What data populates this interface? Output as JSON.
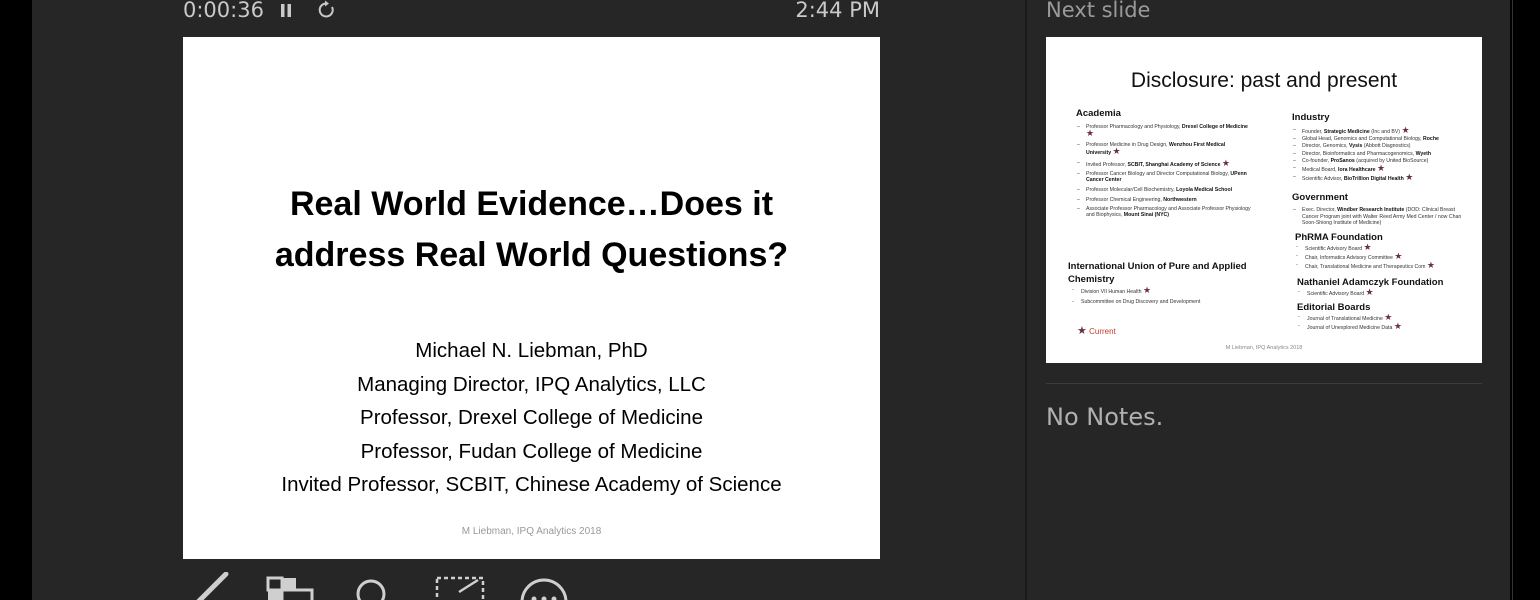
{
  "presenter": {
    "elapsed_time": "0:00:36",
    "clock": "2:44 PM",
    "icons": [
      "pause-icon",
      "restart-icon",
      "pen-icon",
      "slide-grid-icon",
      "zoom-icon",
      "crop-icon",
      "more-icon"
    ]
  },
  "current_slide": {
    "title_lines": [
      "Real World Evidence…Does it",
      "address Real World Questions?"
    ],
    "author_lines": [
      "Michael N. Liebman, PhD",
      "Managing Director, IPQ Analytics, LLC",
      "Professor, Drexel College of Medicine",
      "Professor, Fudan College of Medicine",
      "Invited Professor, SCBIT, Chinese Academy of Science"
    ],
    "footer": "M Liebman, IPQ Analytics 2018"
  },
  "next_slide": {
    "label": "Next slide",
    "title": "Disclosure: past and present",
    "sections": {
      "academia": "Academia",
      "iupac": "International Union of Pure and Applied Chemistry",
      "industry": "Industry",
      "government": "Government",
      "phrma": "PhRMA Foundation",
      "adamczyk": "Nathaniel Adamczyk Foundation",
      "editorial": "Editorial Boards"
    },
    "academia_items": {
      "a1_text": "Professor Pharmacology and Physiology, ",
      "a1_bold": "Drexel College of Medicine",
      "a2_text": "Professor Medicine in Drug Design, ",
      "a2_bold": "Wenzhou First Medical University",
      "a3_text": "Invited Professor, ",
      "a3_bold": "SCBIT, Shanghai Academy of Science",
      "a4_text": "Professor Cancer Biology and Director Computational Biology, ",
      "a4_bold": "UPenn Cancer Center",
      "a5_text": "Professor Molecular/Cell Biochemistry, ",
      "a5_bold": "Loyola Medical School",
      "a6_text": "Professor Chemical Engineering, ",
      "a6_bold": "Northwestern",
      "a7_text": "Associate Professor Pharmacology and Associate Professor Physiology and Biophysics, ",
      "a7_bold": "Mount Sinai (NYC)"
    },
    "iupac_items": [
      "Division VII Human Health",
      "Subcommittee on Drug Discovery and Development"
    ],
    "industry_items": {
      "i1_text": "Founder, ",
      "i1_bold": "Strategic Medicine",
      "i1_tail": " (Inc and BV)",
      "i2_text": "Global Head, Genomics and Computational Biology, ",
      "i2_bold": "Roche",
      "i3_text": "Director, Genomics, ",
      "i3_bold": "Vysis",
      "i3_tail": " (Abbott Diagnostics)",
      "i4_text": "Director, Bioinformatics and Pharmacogenomics, ",
      "i4_bold": "Wyeth",
      "i5_text": "Co-founder, ",
      "i5_bold": "ProSanos",
      "i5_tail": " (acquired by United BioSource)",
      "i6_text": "Medical Board, ",
      "i6_bold": "Iora Healthcare",
      "i7_text": "Scientific Advisor, ",
      "i7_bold": "BioTrillion Digital Health"
    },
    "government_items": {
      "g1_text": "Exec. Director, ",
      "g1_bold": "Windber Research Institute",
      "g1_tail": " (DOD: Clinical Breast Cancer Program joint with Walter Reed Army Med Center / now Chan Soon-Shiong Institute of Medicine)"
    },
    "phrma_items": [
      "Scientific Advisory Board",
      "Chair, Informatics Advisory Committee",
      "Chair, Translational Medicine and Therapeutics Com"
    ],
    "adamczyk_items": [
      "Scientific Advisory Board"
    ],
    "editorial_items": [
      "Journal of Translational Medicine",
      "Journal of Unexplored Medicine Data"
    ],
    "current_legend": "Current",
    "footer": "M Liebman, IPQ Analytics 2018"
  },
  "notes": {
    "text": "No Notes."
  },
  "colors": {
    "panel_background": "#262626",
    "outer_background": "#000000",
    "star": "#6b2f4a",
    "current_legend": "#c0392b"
  }
}
